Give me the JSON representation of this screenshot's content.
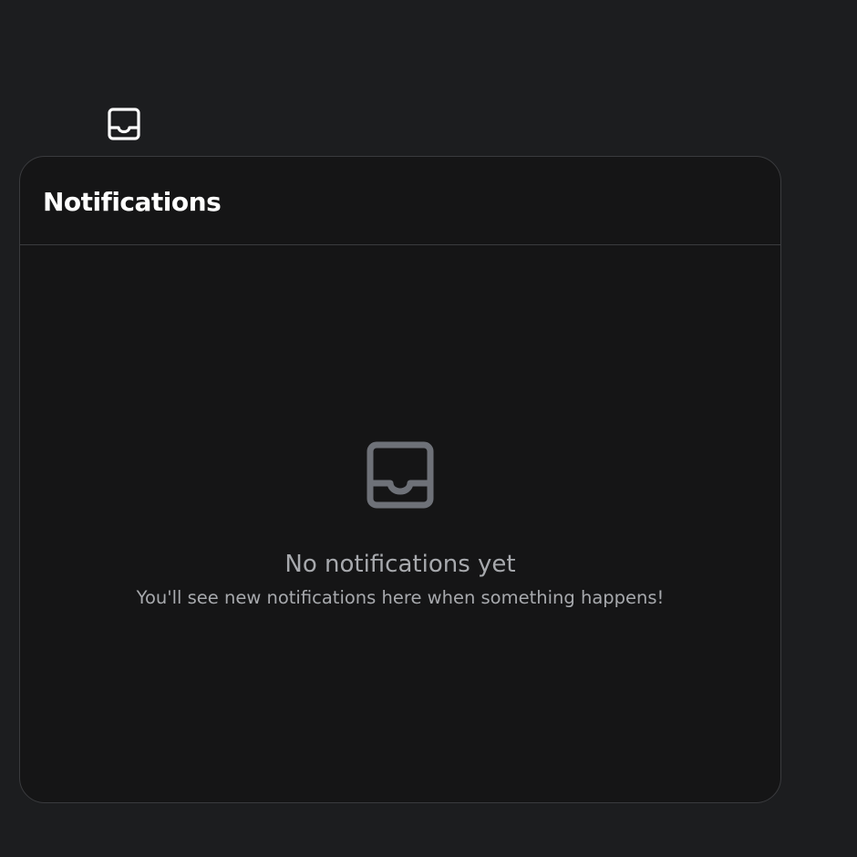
{
  "trigger": {
    "icon": "inbox-icon"
  },
  "panel": {
    "title": "Notifications",
    "empty_state": {
      "icon": "inbox-icon",
      "title": "No notifications yet",
      "subtitle": "You'll see new notifications here when something happens!"
    }
  },
  "colors": {
    "page_background": "#1c1d1f",
    "panel_background": "#151516",
    "panel_border": "#3a3b3e",
    "title_text": "#ffffff",
    "muted_text": "#a7a9ad",
    "empty_icon": "#6e7178"
  }
}
